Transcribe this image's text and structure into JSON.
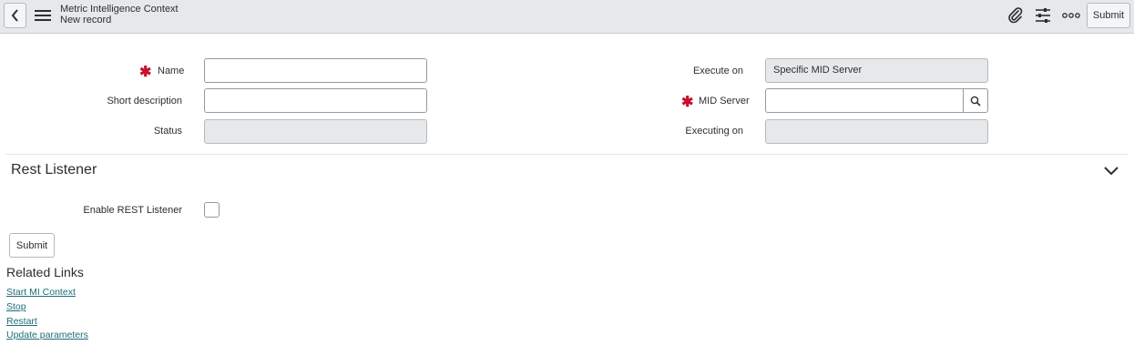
{
  "header": {
    "title": "Metric Intelligence Context",
    "subtitle": "New record",
    "submit_label": "Submit",
    "icons": [
      "chevron-left-icon",
      "hamburger-menu-icon",
      "paperclip-icon",
      "sliders-icon",
      "more-icon"
    ]
  },
  "form": {
    "name_label": "Name",
    "short_description_label": "Short description",
    "status_label": "Status",
    "execute_on_label": "Execute on",
    "execute_on_value": "Specific MID Server",
    "mid_server_label": "MID Server",
    "executing_on_label": "Executing on",
    "name_value": "",
    "short_description_value": "",
    "status_value": "",
    "mid_server_value": "",
    "executing_on_value": ""
  },
  "section": {
    "title": "Rest Listener",
    "enable_rest_label": "Enable REST Listener",
    "enable_rest_checked": false
  },
  "submit_label": "Submit",
  "related_links": {
    "title": "Related Links",
    "links": [
      "Start MI Context",
      "Stop",
      "Restart",
      "Update parameters"
    ]
  },
  "colors": {
    "header_bg": "#e6e8ea",
    "required": "#c8102e",
    "link": "#1f6d77",
    "readonly_field_bg": "#e6e8ea"
  }
}
